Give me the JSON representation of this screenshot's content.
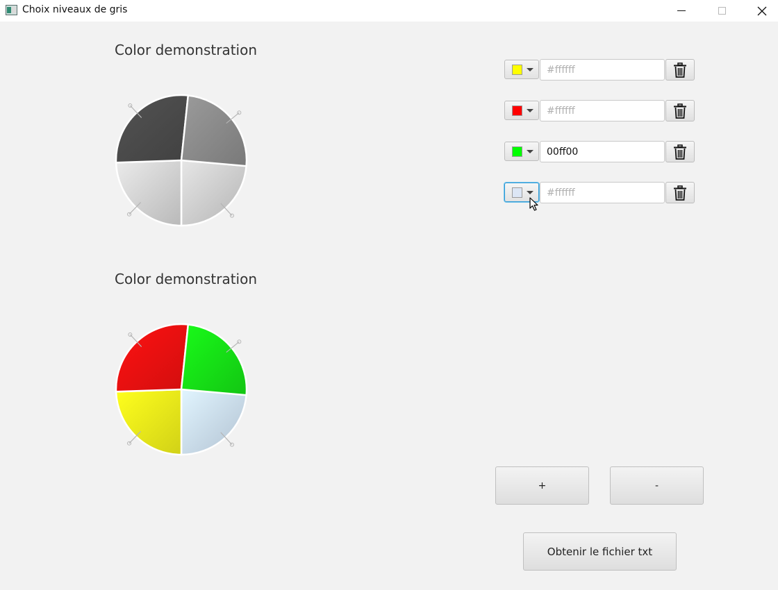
{
  "window": {
    "title": "Choix niveaux de gris",
    "icon": "app-window-icon"
  },
  "charts": [
    {
      "title": "Color demonstration",
      "type": "pie",
      "slices": [
        {
          "start_deg": 5,
          "end_deg": 90,
          "color": "#cdcdcd"
        },
        {
          "start_deg": 90,
          "end_deg": 178,
          "color": "#d2d2d2"
        },
        {
          "start_deg": 178,
          "end_deg": 276,
          "color": "#4a4a4a"
        },
        {
          "start_deg": 276,
          "end_deg": 365,
          "color": "#8a8a8a"
        }
      ]
    },
    {
      "title": "Color demonstration",
      "type": "pie",
      "slices": [
        {
          "start_deg": 5,
          "end_deg": 90,
          "color": "#c9dbee"
        },
        {
          "start_deg": 90,
          "end_deg": 178,
          "color": "#eded1a"
        },
        {
          "start_deg": 178,
          "end_deg": 276,
          "color": "#ee1010"
        },
        {
          "start_deg": 276,
          "end_deg": 365,
          "color": "#16e016"
        }
      ]
    }
  ],
  "color_rows": [
    {
      "swatch_color": "#ffff00",
      "value": "",
      "placeholder": "#ffffff",
      "focused": false
    },
    {
      "swatch_color": "#ff0000",
      "value": "",
      "placeholder": "#ffffff",
      "focused": false
    },
    {
      "swatch_color": "#00ff00",
      "value": "00ff00",
      "placeholder": "#ffffff",
      "focused": false
    },
    {
      "swatch_color": "#dce6f5",
      "value": "",
      "placeholder": "#ffffff",
      "focused": true
    }
  ],
  "buttons": {
    "add_label": "+",
    "remove_label": "-",
    "export_label": "Obtenir le fichier txt"
  },
  "colors": {
    "background": "#f2f2f2",
    "focus_accent": "#2e9bd6"
  }
}
